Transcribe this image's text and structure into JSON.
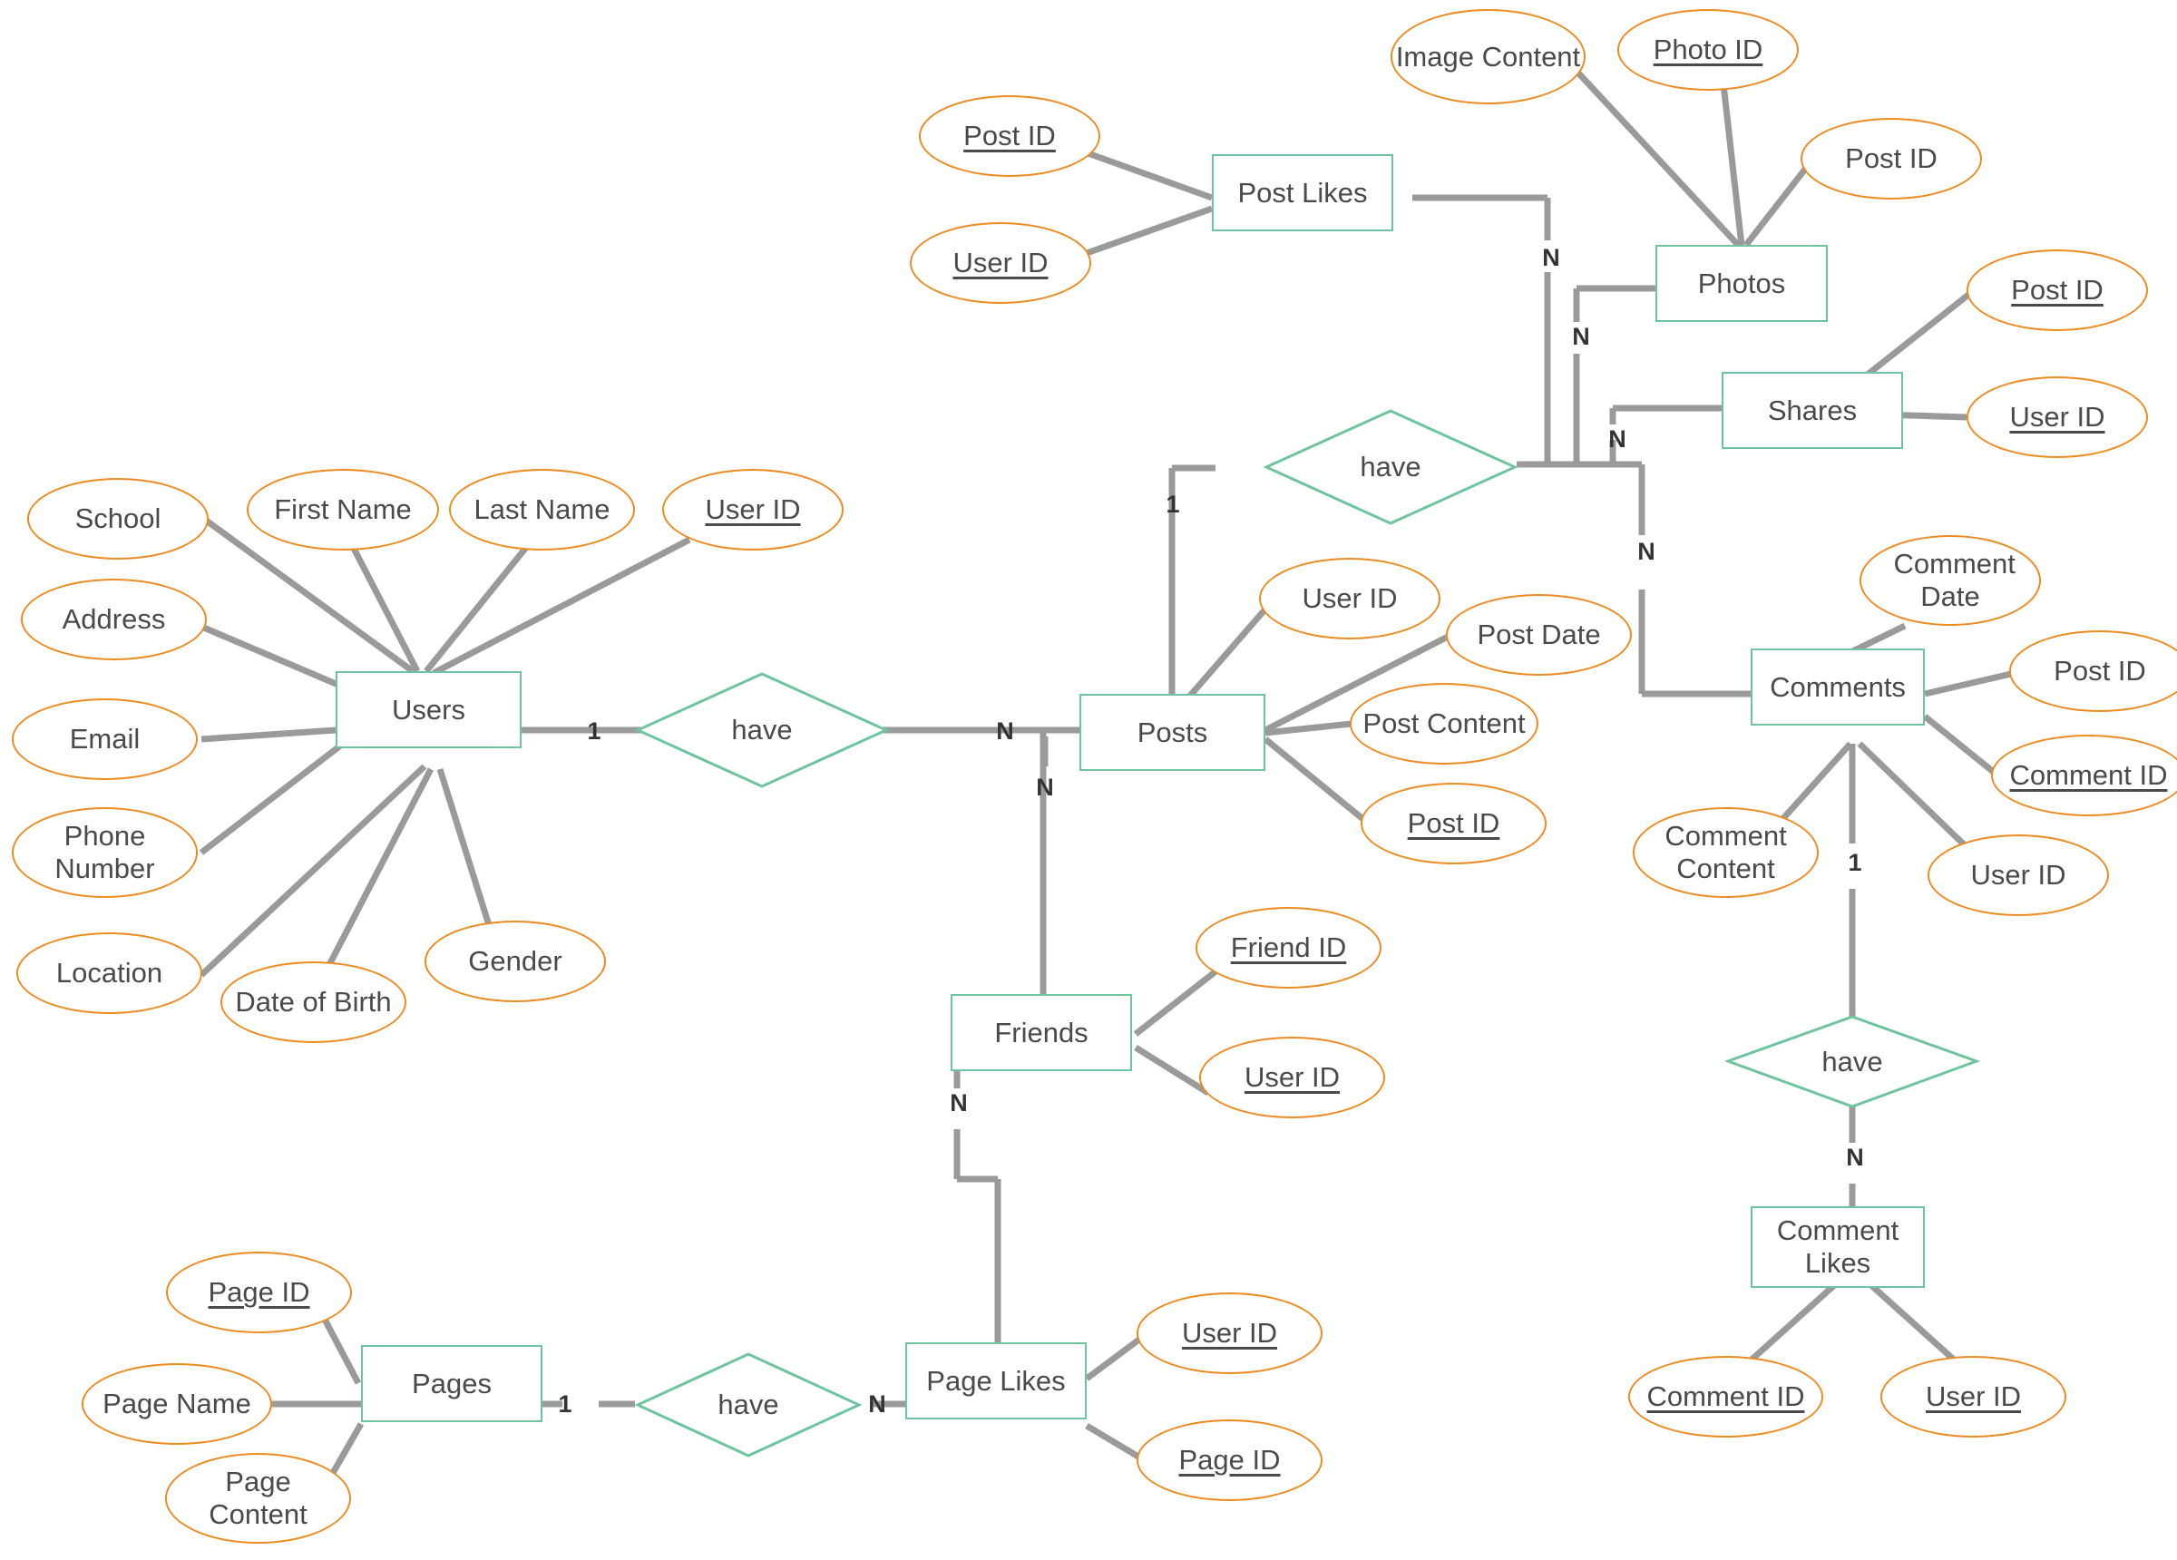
{
  "diagram": {
    "title": "Social Network ER Diagram",
    "colors": {
      "entity_border": "#6ec49f",
      "attribute_border": "#ed8b21",
      "edge": "#9a9a9a",
      "text": "#4a4a4a",
      "background": "#ffffff"
    },
    "entities": [
      {
        "id": "post_likes",
        "label": "Post Likes"
      },
      {
        "id": "photos",
        "label": "Photos"
      },
      {
        "id": "shares",
        "label": "Shares"
      },
      {
        "id": "users",
        "label": "Users"
      },
      {
        "id": "posts",
        "label": "Posts"
      },
      {
        "id": "comments",
        "label": "Comments"
      },
      {
        "id": "friends",
        "label": "Friends"
      },
      {
        "id": "comment_likes",
        "label": "Comment Likes"
      },
      {
        "id": "pages",
        "label": "Pages"
      },
      {
        "id": "page_likes",
        "label": "Page Likes"
      }
    ],
    "relationships": [
      {
        "id": "rel_users_posts",
        "label": "have"
      },
      {
        "id": "rel_posts_media",
        "label": "have"
      },
      {
        "id": "rel_comments_likes",
        "label": "have"
      },
      {
        "id": "rel_pages_likes",
        "label": "have"
      }
    ],
    "attributes": [
      {
        "id": "pl_post_id",
        "label": "Post ID",
        "key": true,
        "entity": "post_likes"
      },
      {
        "id": "pl_user_id",
        "label": "User ID",
        "key": true,
        "entity": "post_likes"
      },
      {
        "id": "ph_image",
        "label": "Image Content",
        "key": false,
        "entity": "photos"
      },
      {
        "id": "ph_photo_id",
        "label": "Photo ID",
        "key": true,
        "entity": "photos"
      },
      {
        "id": "ph_post_id",
        "label": "Post ID",
        "key": false,
        "entity": "photos"
      },
      {
        "id": "sh_post_id",
        "label": "Post ID",
        "key": true,
        "entity": "shares"
      },
      {
        "id": "sh_user_id",
        "label": "User ID",
        "key": true,
        "entity": "shares"
      },
      {
        "id": "u_school",
        "label": "School",
        "key": false,
        "entity": "users"
      },
      {
        "id": "u_first",
        "label": "First Name",
        "key": false,
        "entity": "users"
      },
      {
        "id": "u_last",
        "label": "Last Name",
        "key": false,
        "entity": "users"
      },
      {
        "id": "u_user_id",
        "label": "User ID",
        "key": true,
        "entity": "users"
      },
      {
        "id": "u_address",
        "label": "Address",
        "key": false,
        "entity": "users"
      },
      {
        "id": "u_email",
        "label": "Email",
        "key": false,
        "entity": "users"
      },
      {
        "id": "u_phone",
        "label": "Phone Number",
        "key": false,
        "entity": "users"
      },
      {
        "id": "u_location",
        "label": "Location",
        "key": false,
        "entity": "users"
      },
      {
        "id": "u_dob",
        "label": "Date of Birth",
        "key": false,
        "entity": "users"
      },
      {
        "id": "u_gender",
        "label": "Gender",
        "key": false,
        "entity": "users"
      },
      {
        "id": "po_user_id",
        "label": "User ID",
        "key": false,
        "entity": "posts"
      },
      {
        "id": "po_date",
        "label": "Post Date",
        "key": false,
        "entity": "posts"
      },
      {
        "id": "po_content",
        "label": "Post Content",
        "key": false,
        "entity": "posts"
      },
      {
        "id": "po_post_id",
        "label": "Post ID",
        "key": true,
        "entity": "posts"
      },
      {
        "id": "c_date",
        "label": "Comment Date",
        "key": false,
        "entity": "comments"
      },
      {
        "id": "c_post_id",
        "label": "Post ID",
        "key": false,
        "entity": "comments"
      },
      {
        "id": "c_comment_id",
        "label": "Comment ID",
        "key": true,
        "entity": "comments"
      },
      {
        "id": "c_content",
        "label": "Comment Content",
        "key": false,
        "entity": "comments"
      },
      {
        "id": "c_user_id",
        "label": "User ID",
        "key": false,
        "entity": "comments"
      },
      {
        "id": "f_friend_id",
        "label": "Friend ID",
        "key": true,
        "entity": "friends"
      },
      {
        "id": "f_user_id",
        "label": "User ID",
        "key": true,
        "entity": "friends"
      },
      {
        "id": "cl_comment_id",
        "label": "Comment ID",
        "key": true,
        "entity": "comment_likes"
      },
      {
        "id": "cl_user_id",
        "label": "User ID",
        "key": true,
        "entity": "comment_likes"
      },
      {
        "id": "pg_page_id",
        "label": "Page ID",
        "key": true,
        "entity": "pages"
      },
      {
        "id": "pg_name",
        "label": "Page Name",
        "key": false,
        "entity": "pages"
      },
      {
        "id": "pg_content",
        "label": "Page Content",
        "key": false,
        "entity": "pages"
      },
      {
        "id": "pgl_user_id",
        "label": "User ID",
        "key": true,
        "entity": "page_likes"
      },
      {
        "id": "pgl_page_id",
        "label": "Page ID",
        "key": true,
        "entity": "page_likes"
      }
    ],
    "cardinalities": [
      {
        "id": "card_users_1",
        "label": "1"
      },
      {
        "id": "card_posts_n",
        "label": "N"
      },
      {
        "id": "card_friends_n",
        "label": "N"
      },
      {
        "id": "card_pagelikes_n",
        "label": "N"
      },
      {
        "id": "card_posts_1",
        "label": "1"
      },
      {
        "id": "card_postlikes_n",
        "label": "N"
      },
      {
        "id": "card_photos_n",
        "label": "N"
      },
      {
        "id": "card_shares_n",
        "label": "N"
      },
      {
        "id": "card_comments_n",
        "label": "N"
      },
      {
        "id": "card_comments_1",
        "label": "1"
      },
      {
        "id": "card_commentlikes_n",
        "label": "N"
      },
      {
        "id": "card_pages_1",
        "label": "1"
      },
      {
        "id": "card_pglikes_n",
        "label": "N"
      }
    ]
  }
}
